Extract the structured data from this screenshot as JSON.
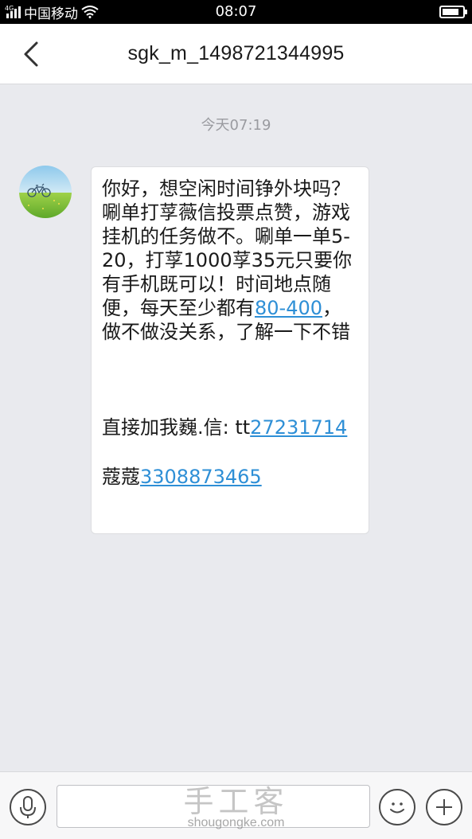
{
  "status_bar": {
    "signal_label": "4G",
    "carrier": "中国移动",
    "time": "08:07",
    "icons": [
      "signal-icon",
      "wifi-icon",
      "battery-icon"
    ]
  },
  "header": {
    "title": "sgk_m_1498721344995",
    "back_icon": "chevron-left-icon"
  },
  "conversation": {
    "timestamp": "今天07:19",
    "message": {
      "text_part1": "你好，想空闲时间铮外块吗？唰单打莩薇信投票点赞，游戏挂机的任务做不。唰单一单5-20，打莩1000莩35元只要你有手机既可以！时间地点随便，每天至少都有",
      "link1": "80-400",
      "text_part2": "，做不做没关系，了解一下不错",
      "contact_prefix": "直接加我巍.信: tt",
      "link2": "27231714",
      "phone_prefix": "蔻蔻",
      "link3": "3308873465"
    }
  },
  "input_bar": {
    "mic_icon": "microphone-icon",
    "emoji_icon": "smiley-icon",
    "add_icon": "plus-icon",
    "input_value": ""
  },
  "watermark": {
    "logo_text": "手工客",
    "url": "shougongke.com"
  },
  "colors": {
    "link": "#2e8fd6",
    "background": "#e9eaee",
    "bubble": "#ffffff"
  }
}
